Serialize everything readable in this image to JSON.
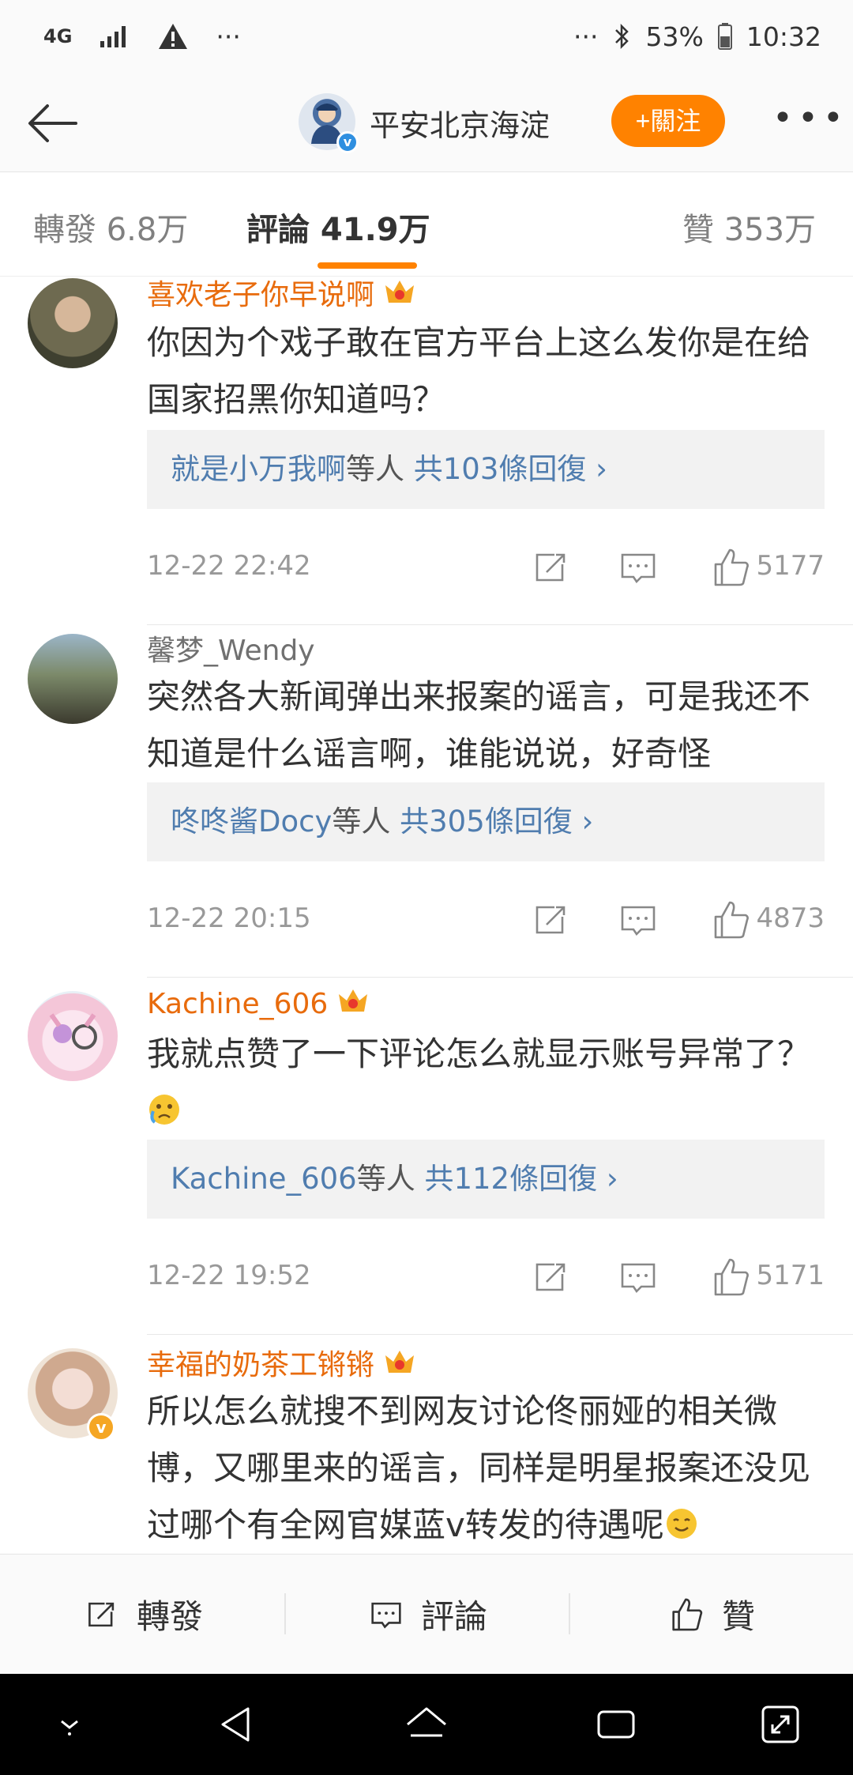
{
  "status_bar": {
    "network": "4G",
    "ellipsis_left": "···",
    "ellipsis_right": "···",
    "battery": "53%",
    "time": "10:32"
  },
  "header": {
    "title": "平安北京海淀",
    "follow_label": "+關注"
  },
  "tabs": [
    {
      "label": "轉發 6.8万"
    },
    {
      "label": "評論 41.9万"
    },
    {
      "label": "贊 353万"
    }
  ],
  "comments": [
    {
      "user": "喜欢老子你早说啊",
      "text": "你因为个戏子敢在官方平台上这么发你是在给国家招黑你知道吗？",
      "reply_user": "就是小万我啊",
      "reply_middle": "等人",
      "reply_count": "共103條回復",
      "time": "12-22 22:42",
      "likes": "5177"
    },
    {
      "user": "馨梦_Wendy",
      "text": "突然各大新闻弹出来报案的谣言，可是我还不知道是什么谣言啊，谁能说说，好奇怪",
      "reply_user": "咚咚酱Docy",
      "reply_middle": "等人",
      "reply_count": "共305條回復",
      "time": "12-22 20:15",
      "likes": "4873"
    },
    {
      "user": "Kachine_606",
      "text": "我就点赞了一下评论怎么就显示账号异常了？",
      "reply_user": "Kachine_606",
      "reply_middle": "等人",
      "reply_count": "共112條回復",
      "time": "12-22 19:52",
      "likes": "5171"
    },
    {
      "user": "幸福的奶茶工锵锵",
      "text": "所以怎么就搜不到网友讨论佟丽娅的相关微博，又哪里来的谣言，同样是明星报案还没见过哪个有全网官媒蓝v转发的待遇呢"
    }
  ],
  "bottom_bar": {
    "repost": "轉發",
    "comment": "評論",
    "like": "贊"
  },
  "colors": {
    "accent": "#ff8200",
    "username_vip": "#e86b0c",
    "link_blue": "#507daf"
  }
}
